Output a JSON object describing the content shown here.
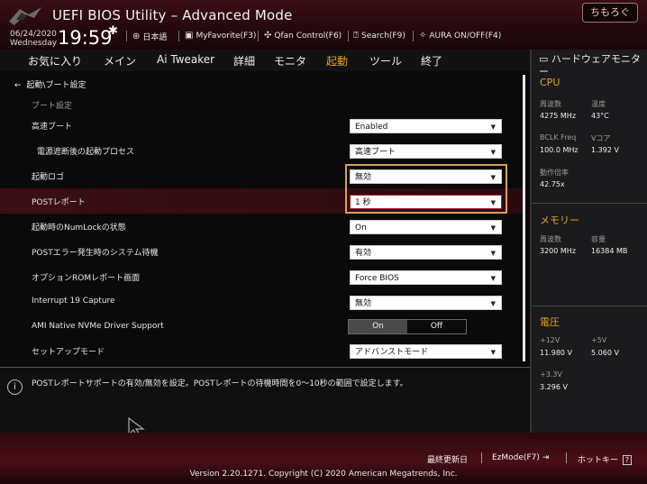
{
  "header": {
    "title": "UEFI BIOS Utility – Advanced Mode",
    "date": "06/24/2020",
    "weekday": "Wednesday",
    "time": "19:59",
    "toolbar": {
      "language": "日本語",
      "myfavorite": "MyFavorite(F3)",
      "qfan": "Qfan Control(F6)",
      "search": "Search(F9)",
      "aura": "AURA ON/OFF(F4)"
    },
    "watermark": "ちもろぐ"
  },
  "nav": {
    "tabs": [
      "お気に入り",
      "メイン",
      "Ai Tweaker",
      "詳細",
      "モニタ",
      "起動",
      "ツール",
      "終了"
    ],
    "active_index": 5
  },
  "main": {
    "breadcrumb": "起動\\ブート設定",
    "section_label": "ブート設定",
    "rows": [
      {
        "label": "高速ブート",
        "value": "Enabled"
      },
      {
        "label": "電源遮断後の起動プロセス",
        "value": "高速ブート"
      },
      {
        "label": "起動ロゴ",
        "value": "無効"
      },
      {
        "label": "POSTレポート",
        "value": "1 秒"
      },
      {
        "label": "起動時のNumLockの状態",
        "value": "On"
      },
      {
        "label": "POSTエラー発生時のシステム待機",
        "value": "有効"
      },
      {
        "label": "オプションROMレポート画面",
        "value": "Force BIOS"
      },
      {
        "label": "Interrupt 19 Capture",
        "value": "無効"
      },
      {
        "label": "AMI Native NVMe Driver Support",
        "on": "On",
        "off": "Off"
      },
      {
        "label": "セットアップモード",
        "value": "アドバンストモード"
      }
    ],
    "highlight_color": "#d7a25a"
  },
  "info": {
    "text": "POSTレポートサポートの有効/無効を設定。POSTレポートの待機時間を0～10秒の範囲で設定します。"
  },
  "hw": {
    "title": "ハードウェアモニター",
    "cpu": {
      "heading": "CPU",
      "freq_label": "周波数",
      "freq": "4275 MHz",
      "temp_label": "温度",
      "temp": "43°C",
      "bclk_label": "BCLK Freq",
      "bclk": "100.0 MHz",
      "vcore_label": "Vコア",
      "vcore": "1.392 V",
      "ratio_label": "動作倍率",
      "ratio": "42.75x"
    },
    "memory": {
      "heading": "メモリー",
      "freq_label": "周波数",
      "freq": "3200 MHz",
      "cap_label": "容量",
      "cap": "16384 MB"
    },
    "voltage": {
      "heading": "電圧",
      "v12_label": "+12V",
      "v12": "11.980 V",
      "v5_label": "+5V",
      "v5": "5.060 V",
      "v33_label": "+3.3V",
      "v33": "3.296 V"
    }
  },
  "footer": {
    "last_modified": "最終更新日",
    "ezmode": "EzMode(F7)",
    "hotkey": "ホットキー",
    "hotkey_glyph": "?",
    "version": "Version 2.20.1271. Copyright (C) 2020 American Megatrends, Inc."
  },
  "colors": {
    "accent": "#e6a21e",
    "header_red": "#3a0d14",
    "select_red": "#b41c22"
  }
}
